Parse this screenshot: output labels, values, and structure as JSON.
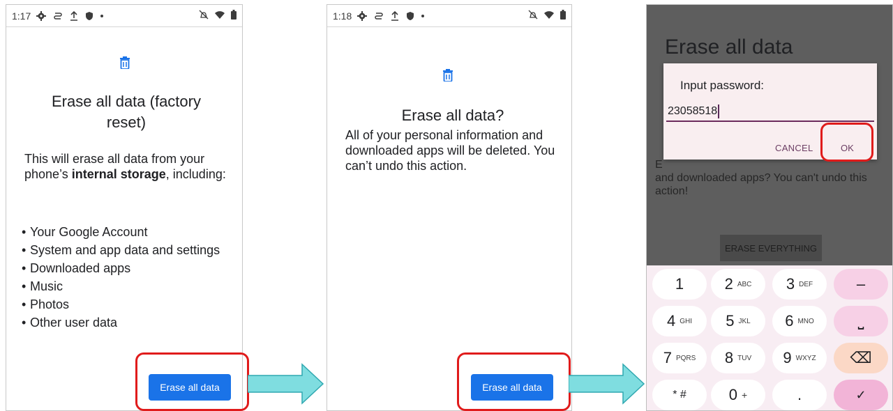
{
  "screen1": {
    "status": {
      "time": "1:17"
    },
    "title": "Erase all data (factory reset)",
    "intro_prefix": "This will erase all data from your phone’s ",
    "intro_bold": "internal storage",
    "intro_suffix": ", including:",
    "items": [
      "Your Google Account",
      "System and app data and settings",
      "Downloaded apps",
      "Music",
      "Photos",
      "Other user data"
    ],
    "button_label": "Erase all data"
  },
  "screen2": {
    "status": {
      "time": "1:18"
    },
    "title": "Erase all data?",
    "body": "All of your personal information and downloaded apps will be deleted. You can’t undo this action.",
    "button_label": "Erase all data"
  },
  "screen3": {
    "title": "Erase all data",
    "body_visible": "and downloaded apps? You can't undo this action!",
    "body_prefix": "E",
    "erase_button": "ERASE EVERYTHING",
    "dialog": {
      "title": "Input password:",
      "value": "23058518",
      "cancel": "CANCEL",
      "ok": "OK"
    },
    "keys": [
      {
        "d": "1",
        "l": ""
      },
      {
        "d": "2",
        "l": "ABC"
      },
      {
        "d": "3",
        "l": "DEF"
      },
      {
        "d": "–",
        "l": ""
      },
      {
        "d": "4",
        "l": "GHI"
      },
      {
        "d": "5",
        "l": "JKL"
      },
      {
        "d": "6",
        "l": "MNO"
      },
      {
        "d": "⎵",
        "l": ""
      },
      {
        "d": "7",
        "l": "PQRS"
      },
      {
        "d": "8",
        "l": "TUV"
      },
      {
        "d": "9",
        "l": "WXYZ"
      },
      {
        "d": "⌫",
        "l": ""
      },
      {
        "d": "* #",
        "l": ""
      },
      {
        "d": "0",
        "l": "+"
      },
      {
        "d": ".",
        "l": ""
      },
      {
        "d": "✓",
        "l": ""
      }
    ]
  },
  "colors": {
    "highlight": "#e01b1b",
    "primary_button": "#1a73e8",
    "arrow": "#7fdde0",
    "dialog_accent": "#6b2a5c"
  }
}
